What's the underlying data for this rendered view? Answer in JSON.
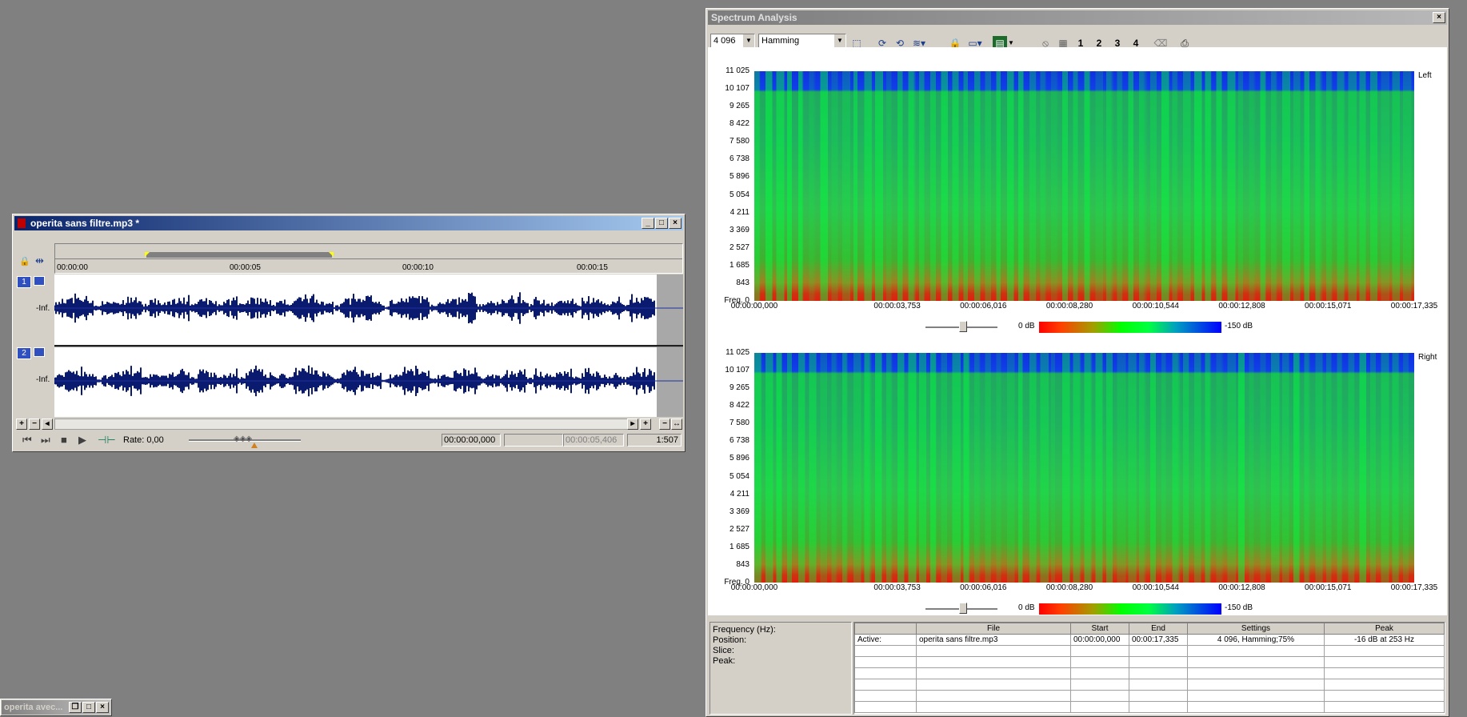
{
  "editor": {
    "title": "operita sans filtre.mp3 *",
    "ruler": [
      "00:00:00",
      "00:00:05",
      "00:00:10",
      "00:00:15"
    ],
    "track1": {
      "num": "1",
      "label": "-Inf."
    },
    "track2": {
      "num": "2",
      "label": "-Inf."
    },
    "rate": "Rate: 0,00",
    "time_start": "00:00:00,000",
    "time_length": "00:00:05,406",
    "zoom": "1:507"
  },
  "minimized": {
    "title": "operita avec..."
  },
  "spectrum": {
    "title": "Spectrum Analysis",
    "fft_size": "4 096",
    "window": "Hamming",
    "toolbar_numbers": [
      "1",
      "2",
      "3",
      "4"
    ],
    "freq_ticks": [
      "11 025",
      "10 107",
      "9 265",
      "8 422",
      "7 580",
      "6 738",
      "5 896",
      "5 054",
      "4 211",
      "3 369",
      "2 527",
      "1 685",
      "843",
      "Freq. 0"
    ],
    "time_ticks": [
      "00:00:00,000",
      "00:00:03,753",
      "00:00:06,016",
      "00:00:08,280",
      "00:00:10,544",
      "00:00:12,808",
      "00:00:15,071",
      "00:00:17,335"
    ],
    "left_label": "Left",
    "right_label": "Right",
    "db_max": "0 dB",
    "db_min": "-150 dB",
    "info_labels": [
      "Frequency (Hz):",
      "Position:",
      "Slice:",
      "Peak:"
    ],
    "table_headers": [
      "",
      "File",
      "Start",
      "End",
      "Settings",
      "Peak"
    ],
    "table_row": [
      "Active:",
      "operita sans filtre.mp3",
      "00:00:00,000",
      "00:00:17,335",
      "4 096, Hamming;75%",
      "-16 dB at 253 Hz"
    ]
  },
  "colors": {
    "title_active": "#0a246a",
    "waveform": "#0a1a6e",
    "scale_low": "#ff0000",
    "scale_mid": "#00ff00",
    "scale_high": "#0000ff"
  }
}
